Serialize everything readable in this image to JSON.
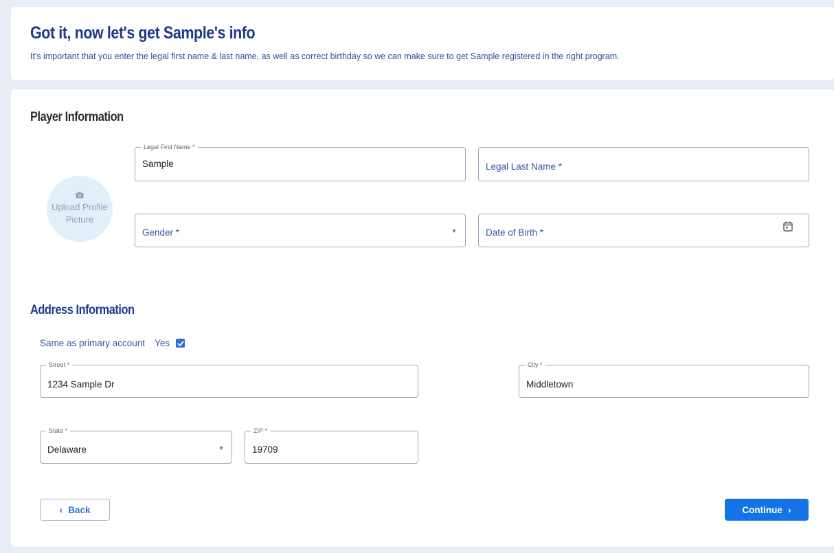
{
  "header": {
    "title": "Got it, now let's get Sample's info",
    "subtitle": "It's important that you enter the legal first name & last name, as well as correct birthday so we can make sure to get Sample registered in the right program."
  },
  "player": {
    "section_title": "Player Information",
    "avatar": {
      "icon": "camera-icon",
      "label_line1": "Upload Profile",
      "label_line2": "Picture"
    },
    "first_name": {
      "label": "Legal First Name *",
      "value": "Sample"
    },
    "last_name": {
      "placeholder": "Legal Last Name *"
    },
    "gender": {
      "placeholder": "Gender *"
    },
    "dob": {
      "placeholder": "Date of Birth *",
      "icon": "calendar-icon"
    }
  },
  "address": {
    "section_title": "Address Information",
    "same_as_label": "Same as primary account",
    "yes_label": "Yes",
    "same_as_checked": true,
    "street": {
      "label": "Street *",
      "value": "1234 Sample Dr"
    },
    "city": {
      "label": "City *",
      "value": "Middletown"
    },
    "state": {
      "label": "State *",
      "value": "Delaware"
    },
    "zip": {
      "label": "ZIP *",
      "value": "19709"
    }
  },
  "actions": {
    "back_label": "Back",
    "continue_label": "Continue"
  },
  "colors": {
    "background": "#e8ecf3",
    "title": "#1e3a8a",
    "accent": "#1473e6",
    "checkbox": "#2c6fd6"
  }
}
